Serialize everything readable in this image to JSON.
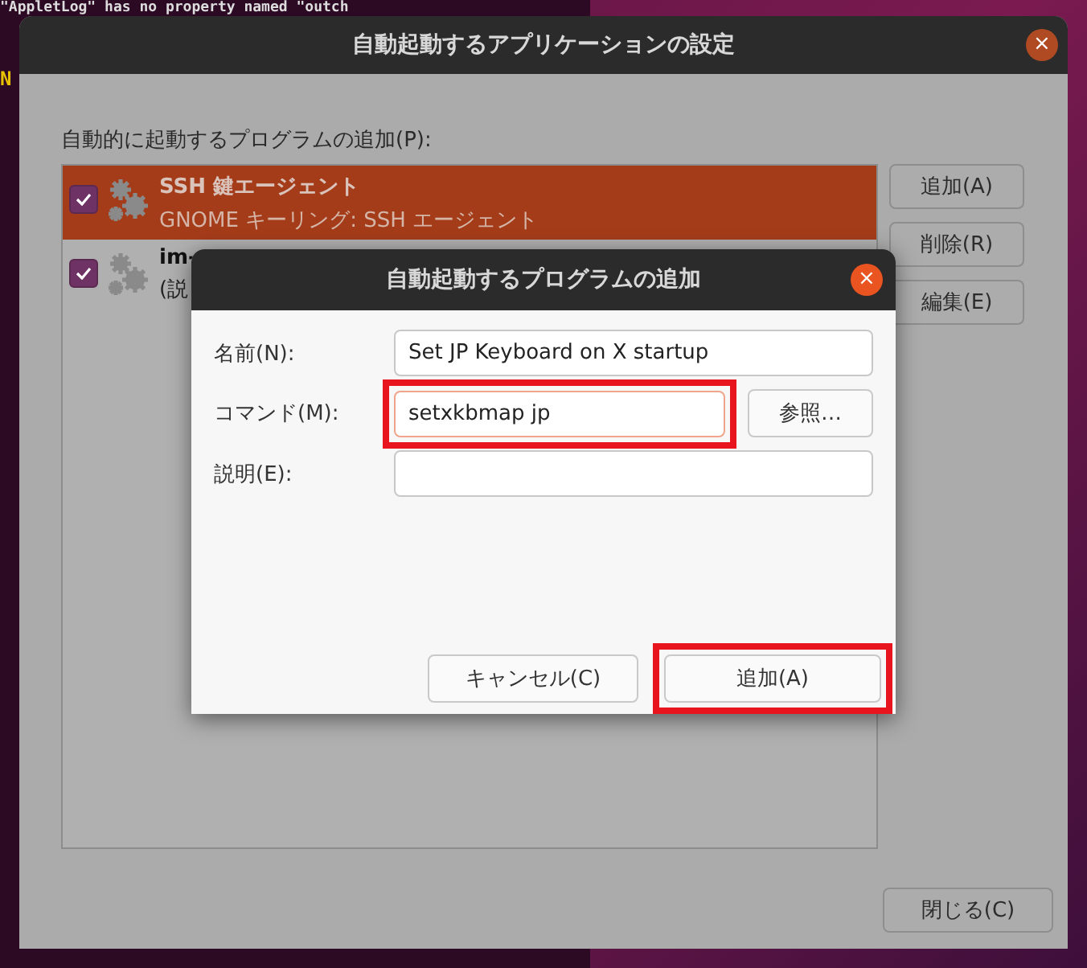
{
  "terminal": {
    "lines": [
      "\"AppletLog\" has no property named \"outch",
      "N"
    ]
  },
  "window": {
    "title": "自動起動するアプリケーションの設定",
    "close": "×"
  },
  "list_label": "自動的に起動するプログラムの追加(P):",
  "programs": [
    {
      "name": "SSH 鍵エージェント",
      "description": "GNOME キーリング: SSH エージェント",
      "checked": true,
      "selected": true
    },
    {
      "name": "im-",
      "description": "(説",
      "checked": true,
      "selected": false
    }
  ],
  "side_buttons": [
    "追加(A)",
    "削除(R)",
    "編集(E)"
  ],
  "close_button": "閉じる(C)",
  "dialog": {
    "title": "自動起動するプログラムの追加",
    "close": "×",
    "fields": [
      {
        "label": "名前(N):",
        "value": "Set JP Keyboard on X startup",
        "highlighted": false
      },
      {
        "label": "コマンド(M):",
        "value": "setxkbmap jp",
        "highlighted": true,
        "browse": "参照…"
      },
      {
        "label": "説明(E):",
        "highlighted": false
      }
    ],
    "buttons": [
      {
        "label": "キャンセル(C)",
        "highlighted": false
      },
      {
        "label": "追加(A)",
        "highlighted": true
      }
    ]
  }
}
